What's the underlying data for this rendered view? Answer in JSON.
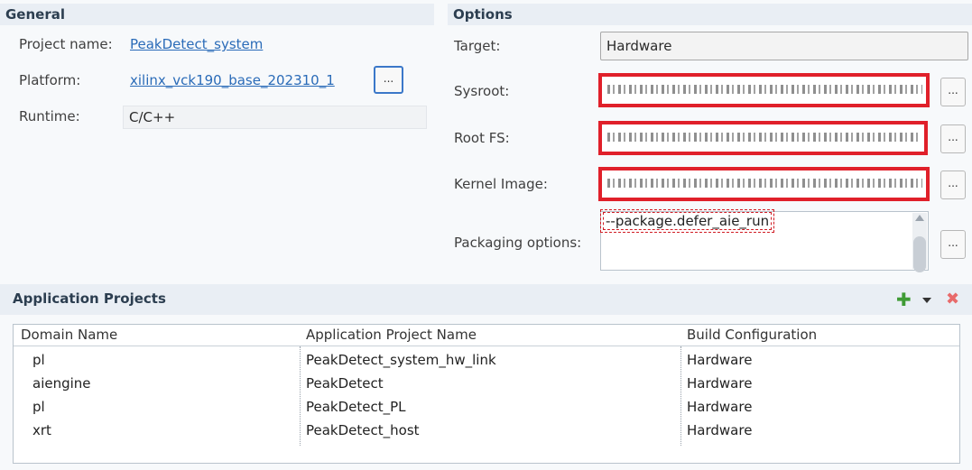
{
  "general": {
    "title": "General",
    "project_name_label": "Project name:",
    "project_name_value": "PeakDetect_system",
    "platform_label": "Platform:",
    "platform_value": "xilinx_vck190_base_202310_1",
    "platform_browse": "...",
    "runtime_label": "Runtime:",
    "runtime_value": "C/C++"
  },
  "options": {
    "title": "Options",
    "target_label": "Target:",
    "target_value": "Hardware",
    "sysroot_label": "Sysroot:",
    "rootfs_label": "Root FS:",
    "kernel_label": "Kernel Image:",
    "packaging_label": "Packaging options:",
    "packaging_value": "--package.defer_aie_run",
    "browse": "..."
  },
  "apps": {
    "title": "Application Projects",
    "columns": [
      "Domain Name",
      "Application Project Name",
      "Build Configuration"
    ],
    "rows": [
      [
        "pl",
        "PeakDetect_system_hw_link",
        "Hardware"
      ],
      [
        "aiengine",
        "PeakDetect",
        "Hardware"
      ],
      [
        "pl",
        "PeakDetect_PL",
        "Hardware"
      ],
      [
        "xrt",
        "PeakDetect_host",
        "Hardware"
      ]
    ],
    "icons": {
      "add": "plus-icon",
      "menu": "dropdown-icon",
      "remove": "remove-icon"
    },
    "colors": {
      "add": "#3f9b35",
      "remove": "#e86a6a"
    }
  },
  "colors": {
    "highlight": "#e0202a",
    "link": "#2a6bb8",
    "header_bg": "#e9eef4"
  }
}
